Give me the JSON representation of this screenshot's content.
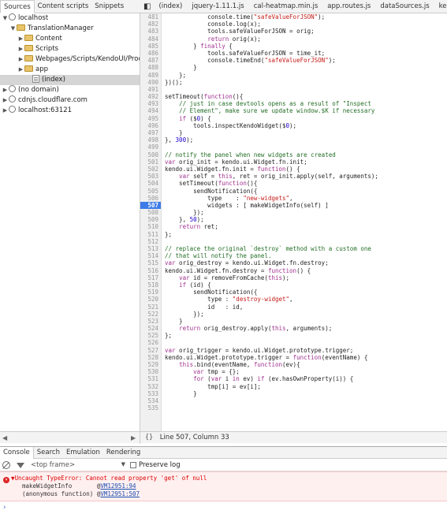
{
  "sources_tabs": [
    "Sources",
    "Content scripts",
    "Snippets"
  ],
  "file_tabs": [
    "(index)",
    "jquery-1.11.1.js",
    "cal-heatmap.min.js",
    "app.routes.js",
    "dataSources.js",
    "kendo"
  ],
  "tree": [
    {
      "label": "localhost",
      "indent": 0,
      "icon": "globe",
      "tri": "▼"
    },
    {
      "label": "TranslationManager",
      "indent": 1,
      "icon": "folder",
      "tri": "▼"
    },
    {
      "label": "Content",
      "indent": 2,
      "icon": "folder",
      "tri": "▶"
    },
    {
      "label": "Scripts",
      "indent": 2,
      "icon": "folder",
      "tri": "▶"
    },
    {
      "label": "Webpages/Scripts/KendoUI/Product",
      "indent": 2,
      "icon": "folder",
      "tri": "▶"
    },
    {
      "label": "app",
      "indent": 2,
      "icon": "folder",
      "tri": "▶"
    },
    {
      "label": "(index)",
      "indent": 3,
      "icon": "file",
      "tri": "",
      "selected": true
    },
    {
      "label": "(no domain)",
      "indent": 0,
      "icon": "globe",
      "tri": "▶"
    },
    {
      "label": "cdnjs.cloudflare.com",
      "indent": 0,
      "icon": "globe",
      "tri": "▶"
    },
    {
      "label": "localhost:63121",
      "indent": 0,
      "icon": "globe",
      "tri": "▶"
    }
  ],
  "breakpoint_line": 507,
  "code_lines": [
    {
      "n": 481,
      "t": "            console.time(\"safeValueForJSON\");"
    },
    {
      "n": 482,
      "t": "            console.log(x);"
    },
    {
      "n": 483,
      "t": "            tools.safeValueForJSON = orig;"
    },
    {
      "n": 484,
      "t": "            return orig(x);"
    },
    {
      "n": 485,
      "t": "        } finally {"
    },
    {
      "n": 486,
      "t": "            tools.safeValueForJSON = time_it;"
    },
    {
      "n": 487,
      "t": "            console.timeEnd(\"safeValueForJSON\");"
    },
    {
      "n": 488,
      "t": "        }"
    },
    {
      "n": 489,
      "t": "    };"
    },
    {
      "n": 490,
      "t": "})();"
    },
    {
      "n": 491,
      "t": ""
    },
    {
      "n": 492,
      "t": "setTimeout(function(){"
    },
    {
      "n": 493,
      "t": "    // just in case devtools opens as a result of \"Inspect"
    },
    {
      "n": 494,
      "t": "    // Element\", make sure we update window.$K if necessary"
    },
    {
      "n": 495,
      "t": "    if ($0) {"
    },
    {
      "n": 496,
      "t": "        tools.inspectKendoWidget($0);"
    },
    {
      "n": 497,
      "t": "    }"
    },
    {
      "n": 498,
      "t": "}, 300);"
    },
    {
      "n": 499,
      "t": ""
    },
    {
      "n": 500,
      "t": "// notify the panel when new widgets are created"
    },
    {
      "n": 501,
      "t": "var orig_init = kendo.ui.Widget.fn.init;"
    },
    {
      "n": 502,
      "t": "kendo.ui.Widget.fn.init = function() {"
    },
    {
      "n": 503,
      "t": "    var self = this, ret = orig_init.apply(self, arguments);"
    },
    {
      "n": 504,
      "t": "    setTimeout(function(){"
    },
    {
      "n": 505,
      "t": "        sendNotification({"
    },
    {
      "n": 506,
      "t": "            type    : \"new-widgets\","
    },
    {
      "n": 507,
      "t": "            widgets : [ makeWidgetInfo(self) ]"
    },
    {
      "n": 508,
      "t": "        });"
    },
    {
      "n": 509,
      "t": "    }, 50);"
    },
    {
      "n": 510,
      "t": "    return ret;"
    },
    {
      "n": 511,
      "t": "};"
    },
    {
      "n": 512,
      "t": ""
    },
    {
      "n": 513,
      "t": "// replace the original `destroy` method with a custom one"
    },
    {
      "n": 514,
      "t": "// that will notify the panel."
    },
    {
      "n": 515,
      "t": "var orig_destroy = kendo.ui.Widget.fn.destroy;"
    },
    {
      "n": 516,
      "t": "kendo.ui.Widget.fn.destroy = function() {"
    },
    {
      "n": 517,
      "t": "    var id = removeFromCache(this);"
    },
    {
      "n": 518,
      "t": "    if (id) {"
    },
    {
      "n": 519,
      "t": "        sendNotification({"
    },
    {
      "n": 520,
      "t": "            type : \"destroy-widget\","
    },
    {
      "n": 521,
      "t": "            id   : id,"
    },
    {
      "n": 522,
      "t": "        });"
    },
    {
      "n": 523,
      "t": "    }"
    },
    {
      "n": 524,
      "t": "    return orig_destroy.apply(this, arguments);"
    },
    {
      "n": 525,
      "t": "};"
    },
    {
      "n": 526,
      "t": ""
    },
    {
      "n": 527,
      "t": "var orig_trigger = kendo.ui.Widget.prototype.trigger;"
    },
    {
      "n": 528,
      "t": "kendo.ui.Widget.prototype.trigger = function(eventName) {"
    },
    {
      "n": 529,
      "t": "    this.bind(eventName, function(ev){"
    },
    {
      "n": 530,
      "t": "        var tmp = {};"
    },
    {
      "n": 531,
      "t": "        for (var i in ev) if (ev.hasOwnProperty(i)) {"
    },
    {
      "n": 532,
      "t": "            tmp[i] = ev[i];"
    },
    {
      "n": 533,
      "t": "        }"
    },
    {
      "n": 534,
      "t": ""
    },
    {
      "n": 535,
      "t": ""
    }
  ],
  "status": {
    "braces": "{}",
    "position": "Line 507, Column 33"
  },
  "console_tabs": [
    "Console",
    "Search",
    "Emulation",
    "Rendering"
  ],
  "console_toolbar": {
    "frame": "<top frame>",
    "preserve_log": "Preserve log"
  },
  "error": {
    "message": "Uncaught TypeError: Cannot read property 'get' of null",
    "stack": [
      {
        "fn": "makeWidgetInfo       ",
        "at": "@",
        "link": "VM12951:94"
      },
      {
        "fn": "(anonymous function)",
        "at": " @",
        "link": "VM12951:507"
      }
    ]
  },
  "prompt": "›"
}
